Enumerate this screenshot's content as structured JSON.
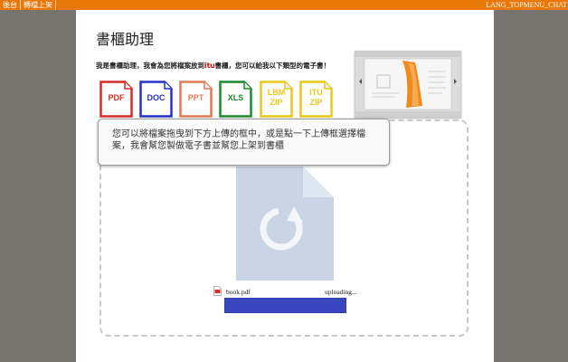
{
  "topbar": {
    "left_buttons": [
      "後台",
      "轉檔上架"
    ],
    "right_text": "LANG_TOPMENU_CHAT"
  },
  "page": {
    "title": "書櫃助理",
    "intro_before": "我是書櫃助理，我會為您將檔案放到",
    "intro_highlight": "itu",
    "intro_after": "書櫃，您可以給我以下類型的電子書！"
  },
  "file_types": [
    {
      "label": "PDF",
      "color": "#d42b2b",
      "icon": "pdf-file-icon"
    },
    {
      "label": "DOC",
      "color": "#2432c8",
      "icon": "doc-file-icon"
    },
    {
      "label": "PPT",
      "color": "#e07a55",
      "icon": "ppt-file-icon"
    },
    {
      "label": "XLS",
      "color": "#1f8a2f",
      "icon": "xls-file-icon"
    },
    {
      "label": "LBM\nZIP",
      "color": "#e8c81a",
      "icon": "lbm-zip-file-icon"
    },
    {
      "label": "ITU\nZIP",
      "color": "#e8c81a",
      "icon": "itu-zip-file-icon"
    }
  ],
  "tooltip": {
    "text": "您可以將檔案拖曳到下方上傳的框中，或是點一下上傳框選擇檔案，我會幫您製做電子書並幫您上架到書櫃"
  },
  "upload": {
    "file_name": "book.pdf",
    "status": "uploading...",
    "progress": 1.0
  },
  "colors": {
    "accent": "#e8780a",
    "progress": "#3a46bf"
  }
}
